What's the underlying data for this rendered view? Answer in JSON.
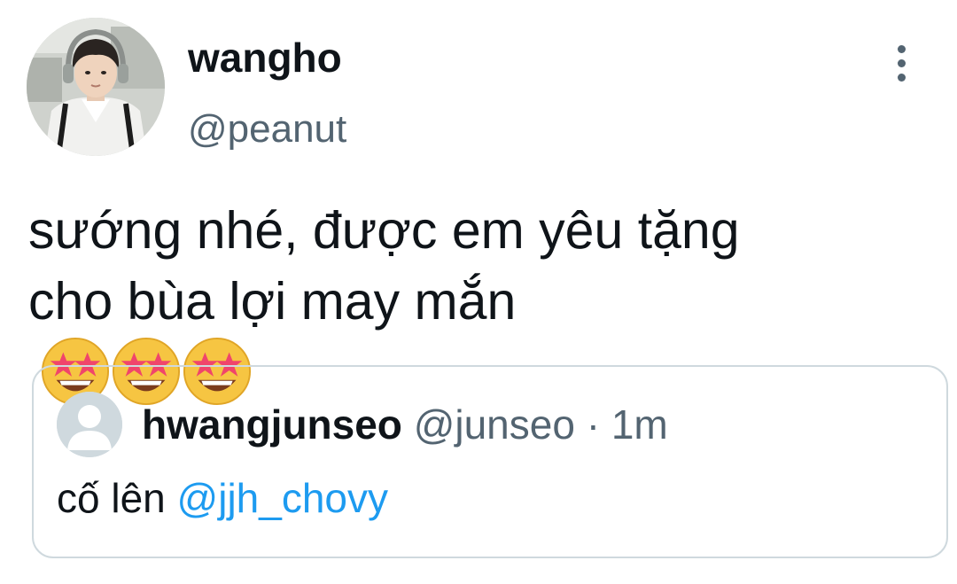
{
  "tweet": {
    "author": {
      "display_name": "wangho",
      "username": "@peanut",
      "avatar_icon": "user-photo-avatar"
    },
    "more_icon": "more-vertical-icon",
    "text_line1": "sướng nhé, được em yêu tặng",
    "text_line2": "cho bùa lợi may mắn",
    "emojis": [
      "star-struck-emoji",
      "star-struck-emoji",
      "star-struck-emoji"
    ]
  },
  "quoted_tweet": {
    "display_name": "hwangjunseo",
    "username": "@junseo",
    "separator": "·",
    "time": "1m",
    "avatar_icon": "default-user-avatar",
    "text_prefix": "cố lên",
    "mention": "@jjh_chovy"
  },
  "colors": {
    "text_primary": "#0f1419",
    "text_secondary": "#536471",
    "link": "#1d9bf0",
    "border": "#cfd9de",
    "background": "#ffffff"
  }
}
